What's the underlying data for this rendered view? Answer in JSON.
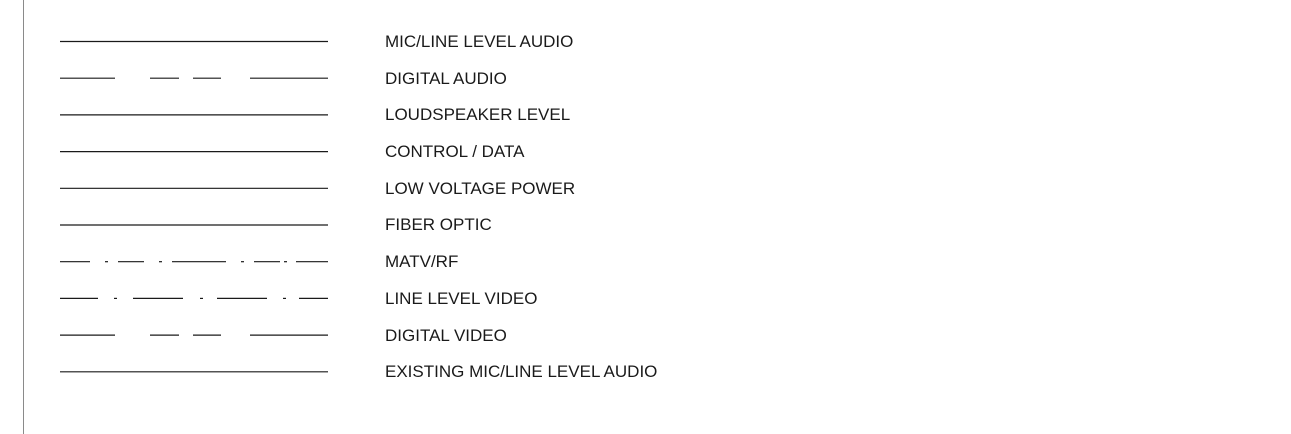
{
  "legend": {
    "items": [
      {
        "label": "MIC/LINE LEVEL AUDIO",
        "line_style": "solid"
      },
      {
        "label": "DIGITAL AUDIO",
        "line_style": "long-dash-short-dash"
      },
      {
        "label": "LOUDSPEAKER LEVEL",
        "line_style": "solid"
      },
      {
        "label": "CONTROL / DATA",
        "line_style": "solid"
      },
      {
        "label": "LOW VOLTAGE POWER",
        "line_style": "solid"
      },
      {
        "label": "FIBER OPTIC",
        "line_style": "solid"
      },
      {
        "label": "MATV/RF",
        "line_style": "dash-dot-dot"
      },
      {
        "label": "LINE LEVEL VIDEO",
        "line_style": "dash-dot"
      },
      {
        "label": "DIGITAL VIDEO",
        "line_style": "long-dash-short-dash"
      },
      {
        "label": "EXISTING MIC/LINE LEVEL AUDIO",
        "line_style": "solid"
      }
    ]
  },
  "colors": {
    "line": "#1a1a1a",
    "text": "#1a1a1a",
    "border": "#8a8a8a",
    "background": "#ffffff"
  }
}
